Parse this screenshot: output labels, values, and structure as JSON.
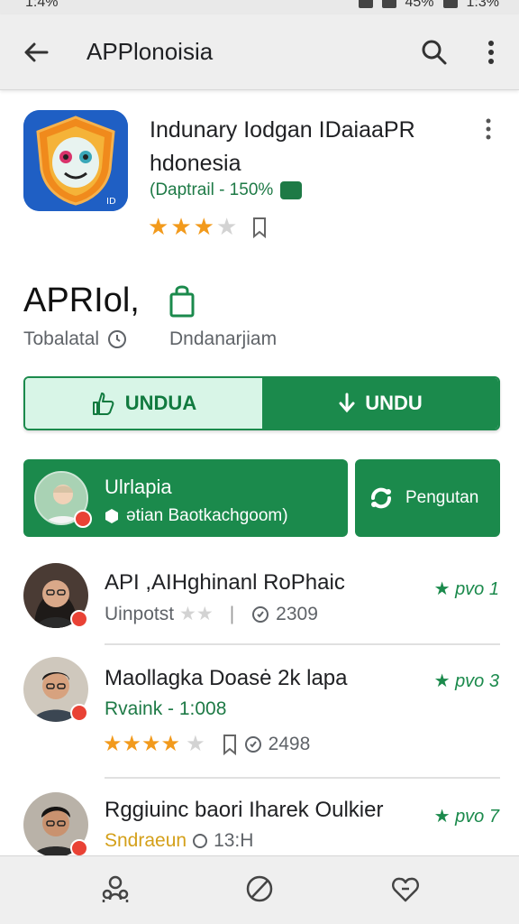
{
  "status_bar": {
    "time": "1:4%",
    "battery": "45%",
    "clock": "1:3%"
  },
  "app_bar": {
    "title": "APPlonoisia"
  },
  "app": {
    "name_line1": "Indunary Iodgan IDaiaaPR",
    "name_line2": "hdonesia",
    "meta": "(Daptrail - 150%",
    "rating": {
      "filled": 3,
      "total": 4
    }
  },
  "section": {
    "title": "APRIol,",
    "meta_left": "Tobalatal",
    "meta_right": "Dndanarjiam"
  },
  "download": {
    "left_label": "UNDUA",
    "right_label": "UNDU"
  },
  "promo": {
    "title": "Ulrlapia",
    "subtitle": "ətian Baotkachgoom)",
    "action_label": "Pengutan"
  },
  "reviews": [
    {
      "name": "API ,AIHghinanl RoPhaic",
      "score": "pvo 1",
      "line2_text": "Uinpotst",
      "stars_filled": 0,
      "stars_shown": 1,
      "count": "2309",
      "line2_color": "#5f6368"
    },
    {
      "name": "Maollagka Doasė 2k lapa",
      "score": "pvo 3",
      "line2_text": "Rvaink - 1:008",
      "stars_filled": 4,
      "stars_shown": 5,
      "count": "2498",
      "line2_color": "#1e7a46"
    },
    {
      "name": "Rggiuinc baori Iharek Oulkier",
      "score": "pvo 7",
      "line2_text": "Sndraeun",
      "count": "13:H",
      "line2_color": "#d4a01a"
    }
  ],
  "colors": {
    "primary_green": "#1b8a4c",
    "star": "#f29a1c",
    "light_green": "#d8f5e7"
  }
}
